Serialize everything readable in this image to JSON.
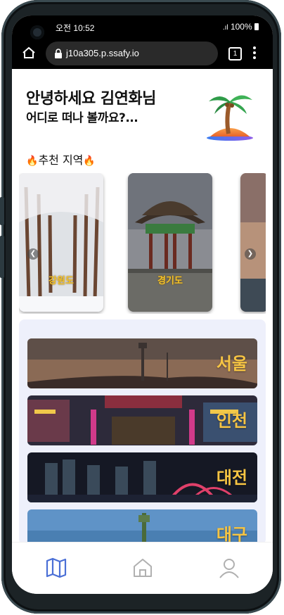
{
  "status": {
    "time": "오전 10:52",
    "battery": "100%"
  },
  "browser": {
    "url": "j10a305.p.ssafy.io",
    "tab_count": "1"
  },
  "greeting": {
    "line1": "안녕하세요 김연화님",
    "line2": "어디로 떠나 볼까요?..."
  },
  "recommend": {
    "title": "추천 지역",
    "fire_icon": "🔥"
  },
  "carousel": [
    {
      "label": "강원도"
    },
    {
      "label": "경기도"
    }
  ],
  "regions": [
    {
      "name": "서울"
    },
    {
      "name": "인천"
    },
    {
      "name": "대전"
    },
    {
      "name": "대구"
    }
  ],
  "nav": {
    "items": [
      "map-icon",
      "home-icon",
      "user-icon"
    ],
    "active_color": "#4a6fd6"
  }
}
